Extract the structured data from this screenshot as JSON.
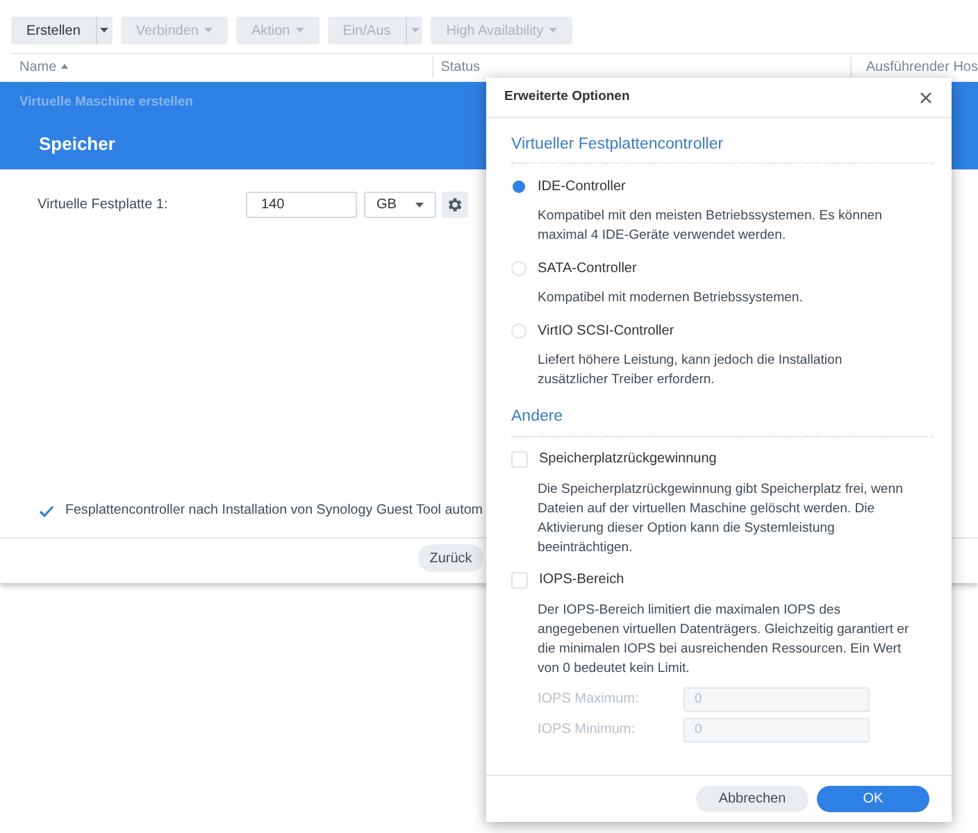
{
  "toolbar": [
    {
      "label": "Erstellen",
      "kind": "split",
      "disabled": false
    },
    {
      "label": "Verbinden",
      "kind": "dropdown",
      "disabled": true
    },
    {
      "label": "Aktion",
      "kind": "dropdown",
      "disabled": true
    },
    {
      "label": "Ein/Aus",
      "kind": "split",
      "disabled": true
    },
    {
      "label": "High Availability",
      "kind": "dropdown",
      "disabled": true
    }
  ],
  "table": {
    "columns": [
      {
        "label": "Name",
        "sorted": true
      },
      {
        "label": "Status",
        "sorted": false
      },
      {
        "label": "Ausführender Hos",
        "sorted": false
      }
    ]
  },
  "wizard": {
    "title": "Virtuelle Maschine erstellen",
    "step": "Speicher",
    "disks": [
      {
        "label": "Virtuelle Festplatte 1:",
        "size": "140",
        "unit": "GB"
      }
    ],
    "auto_controller": {
      "label": "Fesplattencontroller nach Installation von Synology Guest Tool autom",
      "checked": true
    },
    "buttons": [
      "Zurück"
    ]
  },
  "dialog": {
    "title": "Erweiterte Optionen",
    "sections": [
      {
        "heading": "Virtueller Festplattencontroller",
        "options": [
          {
            "kind": "radio",
            "label": "IDE-Controller",
            "selected": true,
            "description": "Kompatibel mit den meisten Betriebssystemen. Es können maximal 4 IDE-Geräte verwendet werden."
          },
          {
            "kind": "radio",
            "label": "SATA-Controller",
            "selected": false,
            "description": "Kompatibel mit modernen Betriebssystemen."
          },
          {
            "kind": "radio",
            "label": "VirtIO SCSI-Controller",
            "selected": false,
            "description": "Liefert höhere Leistung, kann jedoch die Installation zusätzlicher Treiber erfordern."
          }
        ]
      },
      {
        "heading": "Andere",
        "options": [
          {
            "kind": "checkbox",
            "label": "Speicherplatzrückgewinnung",
            "checked": false,
            "description": "Die Speicherplatzrückgewinnung gibt Speicherplatz frei, wenn Dateien auf der virtuellen Maschine gelöscht werden. Die Aktivierung dieser Option kann die Systemleistung beeinträchtigen."
          },
          {
            "kind": "checkbox",
            "label": "IOPS-Bereich",
            "checked": false,
            "description": "Der IOPS-Bereich limitiert die maximalen IOPS des angegebenen virtuellen Datenträgers. Gleichzeitig garantiert er die minimalen IOPS bei ausreichenden Ressourcen. Ein Wert von 0 bedeutet kein Limit.",
            "fields": [
              {
                "label": "IOPS Maximum:",
                "value": "0",
                "disabled": true
              },
              {
                "label": "IOPS Minimum:",
                "value": "0",
                "disabled": true
              }
            ]
          }
        ]
      }
    ],
    "buttons": [
      {
        "label": "Abbrechen",
        "kind": "secondary"
      },
      {
        "label": "OK",
        "kind": "primary"
      }
    ]
  }
}
